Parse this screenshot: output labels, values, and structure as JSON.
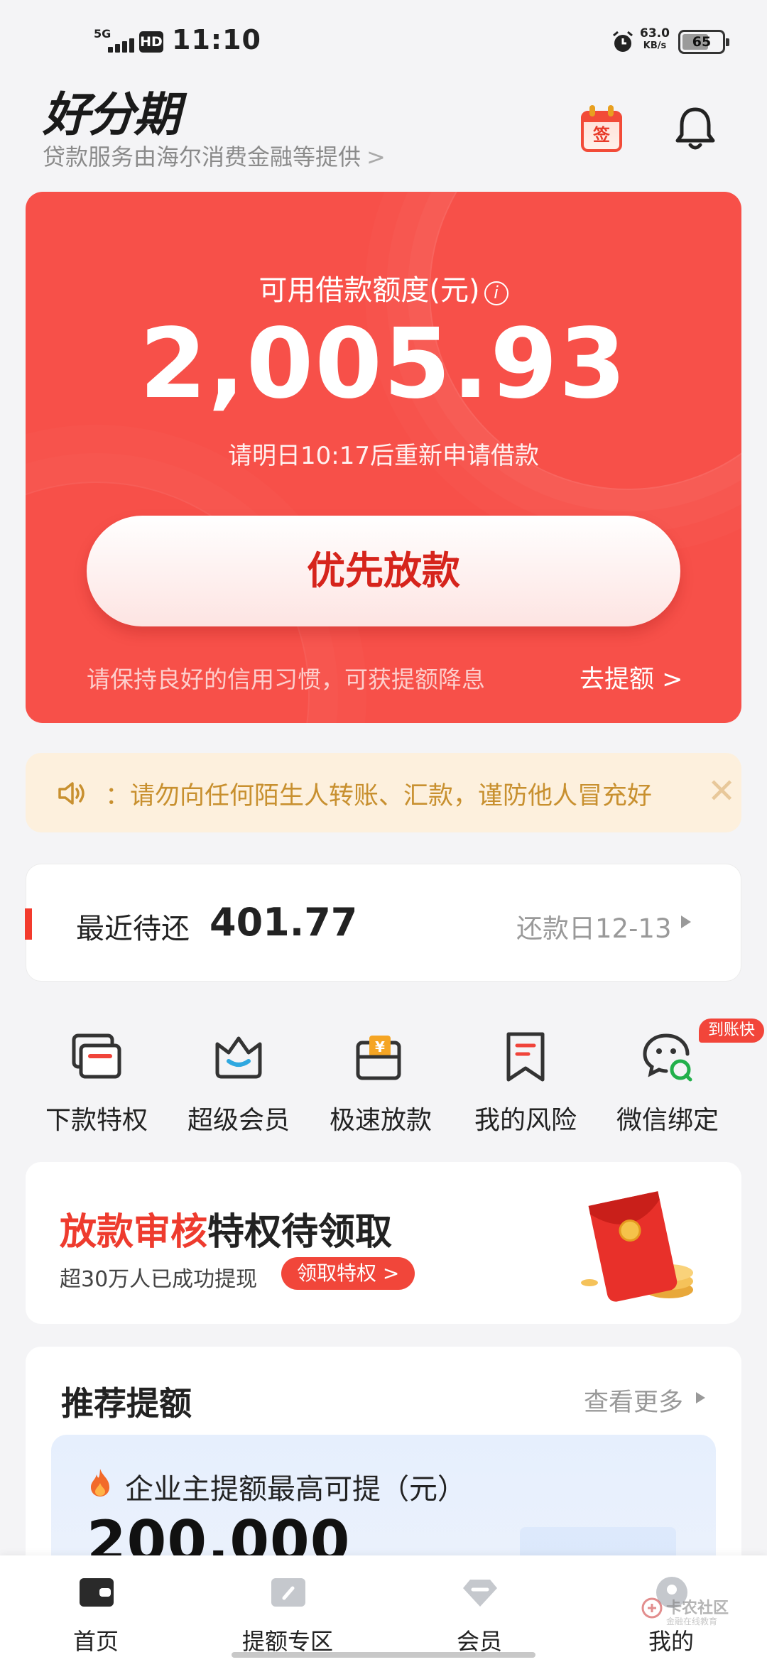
{
  "status_bar": {
    "network": "5G",
    "hd": "HD",
    "time": "11:10",
    "speed_value": "63.0",
    "speed_unit": "KB/s",
    "battery": "65"
  },
  "header": {
    "logo": "好分期",
    "provider_text": "贷款服务由海尔消费金融等提供",
    "provider_chevron": ">",
    "sign_label": "签"
  },
  "credit": {
    "label": "可用借款额度(元)",
    "info_symbol": "i",
    "amount": "2,005.93",
    "note": "请明日10:17后重新申请借款",
    "button_label": "优先放款",
    "tip": "请保持良好的信用习惯，可获提额降息",
    "raise_label": "去提额 >",
    "color": "#f75049"
  },
  "notice": {
    "text": "：请勿向任何陌生人转账、汇款，谨防他人冒充好",
    "close_symbol": "✕"
  },
  "repay": {
    "label": "最近待还",
    "amount": "401.77",
    "date_label": "还款日12-13"
  },
  "quick_actions": {
    "badge": "到账快",
    "items": [
      {
        "label": "下款特权",
        "icon": "card-stack-icon"
      },
      {
        "label": "超级会员",
        "icon": "crown-icon"
      },
      {
        "label": "极速放款",
        "icon": "yuan-wallet-icon"
      },
      {
        "label": "我的风险",
        "icon": "bookmark-icon"
      },
      {
        "label": "微信绑定",
        "icon": "wechat-icon"
      }
    ]
  },
  "promo": {
    "title_highlight": "放款审核",
    "title_rest": "特权待领取",
    "subtitle": "超30万人已成功提现",
    "button_label": "领取特权 >"
  },
  "recommend": {
    "title": "推荐提额",
    "more_label": "查看更多",
    "card_text": "企业主提额最高可提（元）",
    "card_amount": "200,000"
  },
  "bottom_nav": {
    "items": [
      {
        "label": "首页",
        "icon": "wallet-icon",
        "active": true
      },
      {
        "label": "提额专区",
        "icon": "card-icon",
        "active": false
      },
      {
        "label": "会员",
        "icon": "diamond-icon",
        "active": false
      },
      {
        "label": "我的",
        "icon": "profile-icon",
        "active": false
      }
    ]
  },
  "watermark": {
    "main": "卡农社区",
    "sub": "金融在线教育"
  }
}
